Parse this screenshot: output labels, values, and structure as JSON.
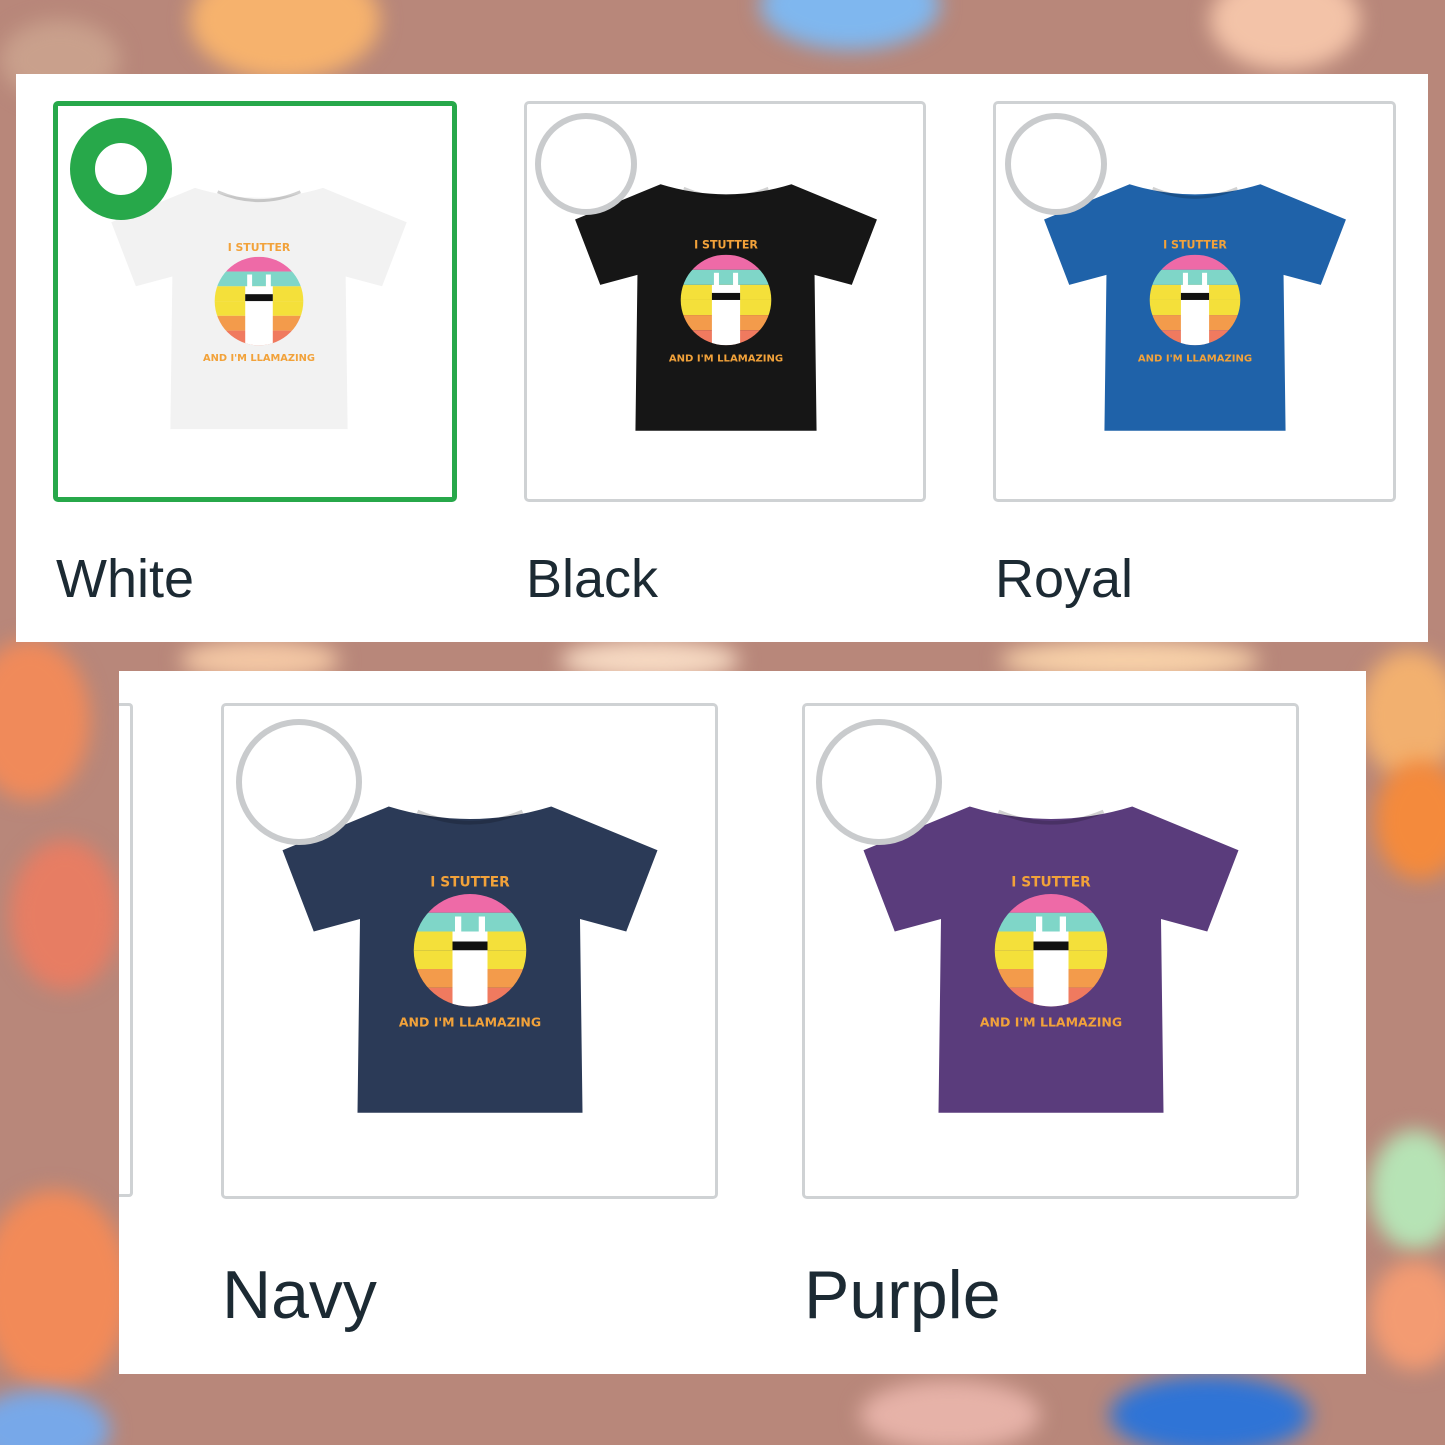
{
  "swatches_top": [
    {
      "label": "White",
      "color": "#f2f2f2",
      "selected": true
    },
    {
      "label": "Black",
      "color": "#161616",
      "selected": false
    },
    {
      "label": "Royal",
      "color": "#1f62a9",
      "selected": false
    }
  ],
  "swatches_bottom": [
    {
      "label": "Navy",
      "color": "#2b3a57",
      "selected": false
    },
    {
      "label": "Purple",
      "color": "#5a3c7c",
      "selected": false
    }
  ],
  "accent_color": "#27a84a",
  "design_icon": "llama-sunset-badge",
  "design_text_top": "I STUTTER",
  "design_text_bottom": "AND I'M LLAMAZING"
}
